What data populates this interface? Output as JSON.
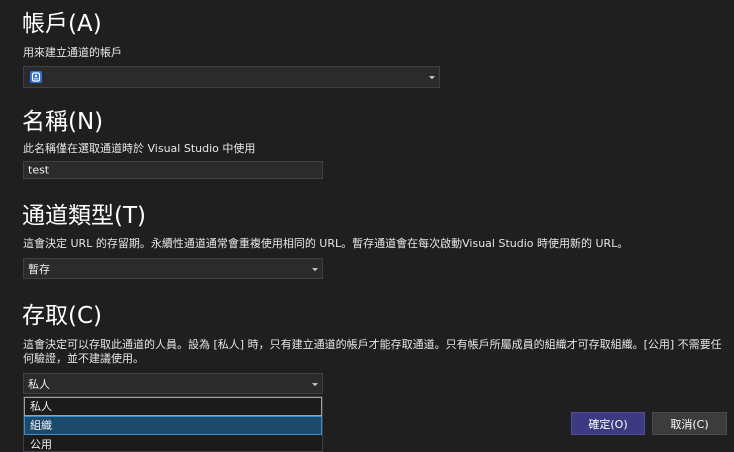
{
  "account": {
    "heading": "帳戶(A)",
    "description": "用來建立通道的帳戶",
    "selected_value": "",
    "icon": "account-badge-icon"
  },
  "name": {
    "heading": "名稱(N)",
    "description": "此名稱僅在選取通道時於 Visual Studio 中使用",
    "value": "test"
  },
  "tunnel_type": {
    "heading": "通道類型(T)",
    "description": "這會決定 URL 的存留期。永續性通道通常會重複使用相同的 URL。暫存通道會在每次啟動Visual Studio 時使用新的 URL。",
    "selected_value": "暫存"
  },
  "access": {
    "heading": "存取(C)",
    "description": "這會決定可以存取此通道的人員。設為 [私人] 時，只有建立通道的帳戶才能存取通道。只有帳戶所屬成員的組織才可存取組織。[公用] 不需要任何驗證，並不建議使用。",
    "selected_value": "私人",
    "options": [
      {
        "label": "私人"
      },
      {
        "label": "組織"
      },
      {
        "label": "公用"
      }
    ]
  },
  "buttons": {
    "ok_label": "確定(O)",
    "cancel_label": "取消(C)"
  },
  "colors": {
    "background": "#1f1f1f",
    "primary_button": "#3d3a83",
    "highlight": "#1b4a6b"
  }
}
